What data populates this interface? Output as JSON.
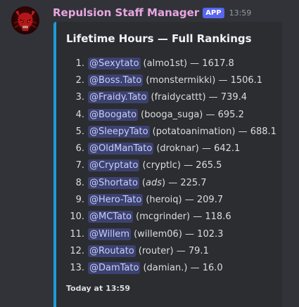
{
  "header": {
    "username": "Repulsion Staff Manager",
    "app_tag": "APP",
    "timestamp": "13:59"
  },
  "embed": {
    "accent_color": "#1d9bd8",
    "title": "Lifetime Hours — Full Rankings",
    "rankings": [
      {
        "rank": "1.",
        "mention": "@Sexytato",
        "handle": "almo1st",
        "hours": "1617.8",
        "italic": false
      },
      {
        "rank": "2.",
        "mention": "@Boss.Tato",
        "handle": "monstermikki",
        "hours": "1506.1",
        "italic": false
      },
      {
        "rank": "3.",
        "mention": "@Fraidy.Tato",
        "handle": "fraidycattt",
        "hours": "739.4",
        "italic": false
      },
      {
        "rank": "4.",
        "mention": "@Boogato",
        "handle": "booga_suga",
        "hours": "695.2",
        "italic": false
      },
      {
        "rank": "5.",
        "mention": "@SleepyTato",
        "handle": "potatoanimation",
        "hours": "688.1",
        "italic": false
      },
      {
        "rank": "6.",
        "mention": "@OldManTato",
        "handle": "droknar",
        "hours": "642.1",
        "italic": false
      },
      {
        "rank": "7.",
        "mention": "@Cryptato",
        "handle": "cryptlc",
        "hours": "265.5",
        "italic": false
      },
      {
        "rank": "8.",
        "mention": "@Shortato",
        "handle": "ads",
        "hours": "225.7",
        "italic": true
      },
      {
        "rank": "9.",
        "mention": "@Hero-Tato",
        "handle": "heroiq",
        "hours": "209.7",
        "italic": false
      },
      {
        "rank": "10.",
        "mention": "@MCTato",
        "handle": "mcgrinder",
        "hours": "118.6",
        "italic": false
      },
      {
        "rank": "11.",
        "mention": "@Willem",
        "handle": "willem06",
        "hours": "102.3",
        "italic": false
      },
      {
        "rank": "12.",
        "mention": "@Routato",
        "handle": "router",
        "hours": "79.1",
        "italic": false
      },
      {
        "rank": "13.",
        "mention": "@DamTato",
        "handle": "damian.",
        "hours": "16.0",
        "italic": false
      }
    ],
    "footer": "Today at 13:59"
  },
  "colors": {
    "background": "#313338",
    "embed_background": "#2b2d31",
    "username": "#e8a6e0",
    "app_tag": "#5865f2",
    "mention_bg": "#3c4270",
    "mention_text": "#c9cdfb"
  },
  "icons": {
    "avatar": "red-demon-skull-avatar"
  }
}
